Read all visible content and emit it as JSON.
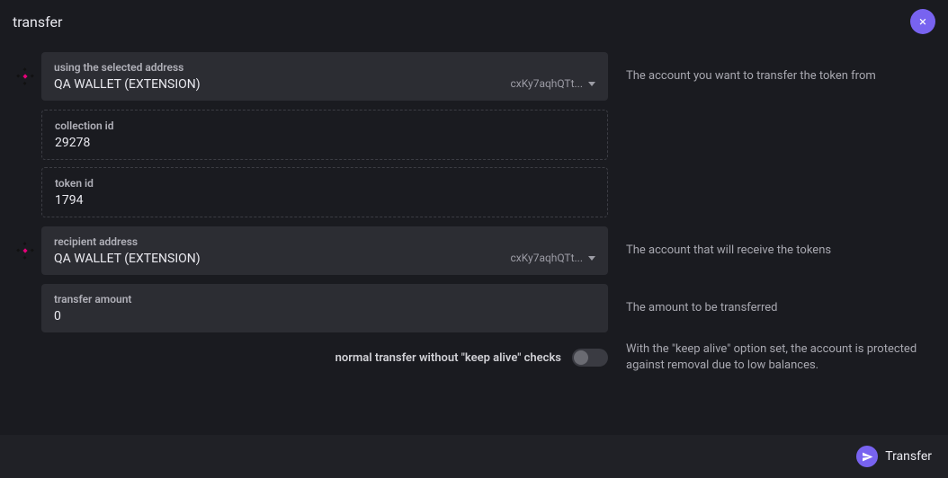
{
  "modal": {
    "title": "transfer",
    "close_label": "×"
  },
  "fields": {
    "from": {
      "label": "using the selected address",
      "name": "QA WALLET (EXTENSION)",
      "short_addr": "cxKy7aqhQTt..."
    },
    "collection_id": {
      "label": "collection id",
      "value": "29278"
    },
    "token_id": {
      "label": "token id",
      "value": "1794"
    },
    "recipient": {
      "label": "recipient address",
      "name": "QA WALLET (EXTENSION)",
      "short_addr": "cxKy7aqhQTt..."
    },
    "amount": {
      "label": "transfer amount",
      "value": "0"
    }
  },
  "help": {
    "from": "The account you want to transfer the token from",
    "recipient": "The account that will receive the tokens",
    "amount": "The amount to be transferred",
    "keep_alive": "With the \"keep alive\" option set, the account is protected against removal due to low balances."
  },
  "toggle": {
    "label": "normal transfer without \"keep alive\" checks"
  },
  "footer": {
    "submit_label": "Transfer"
  }
}
